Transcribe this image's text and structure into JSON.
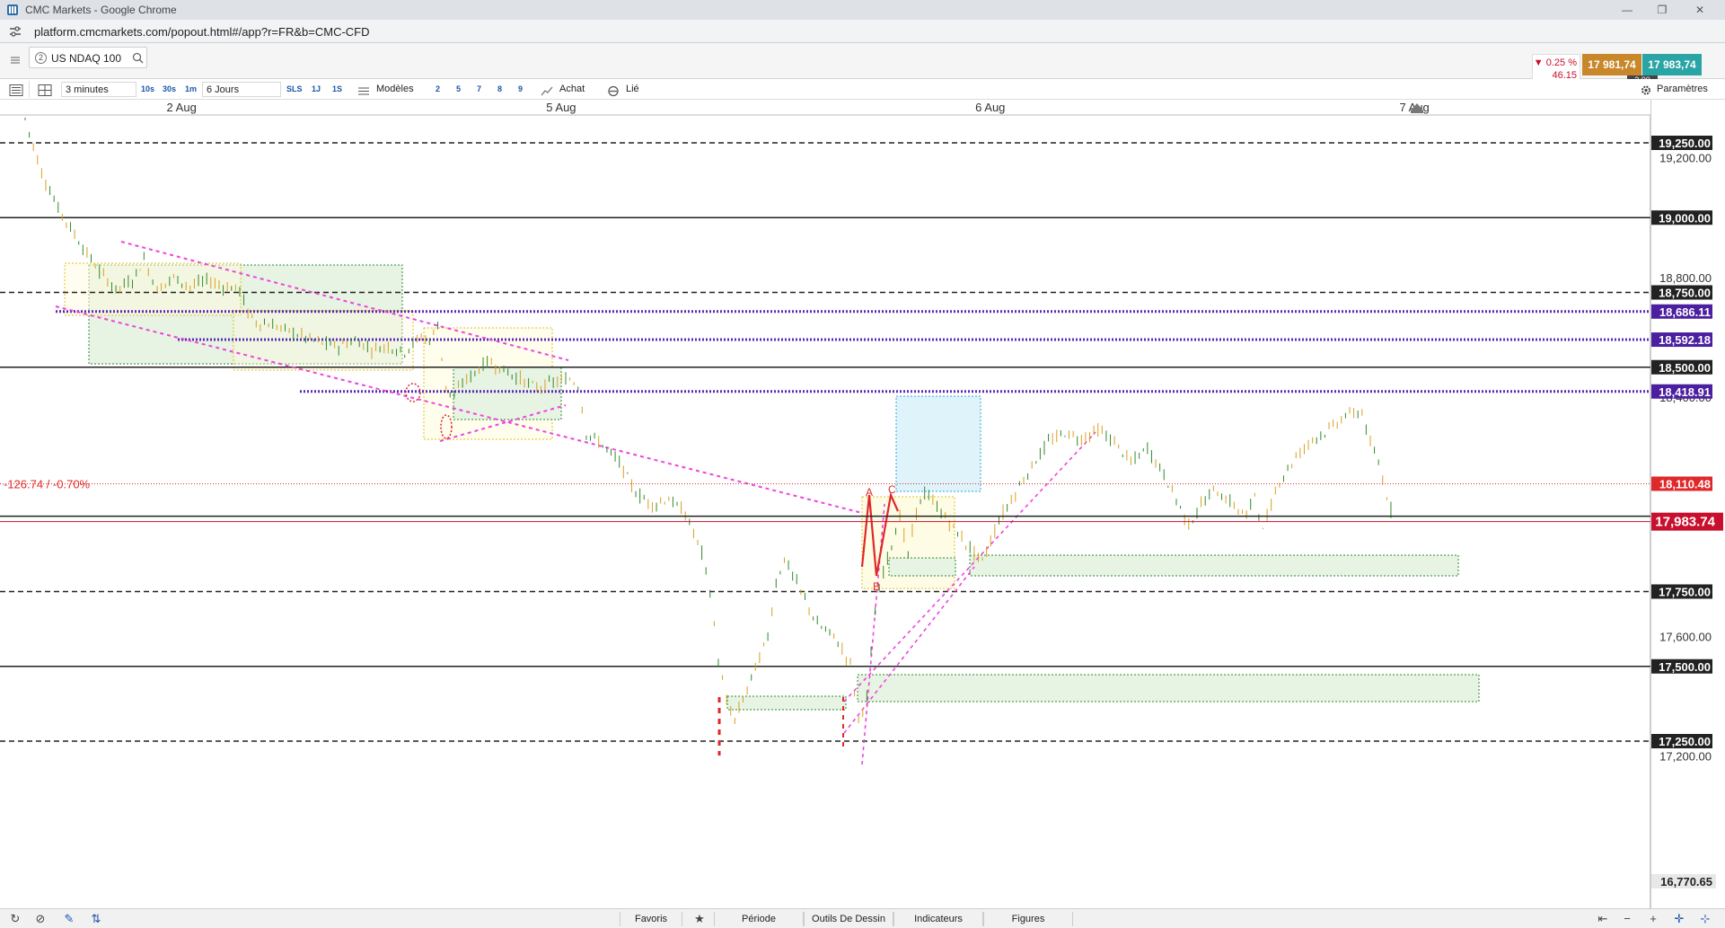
{
  "window": {
    "title": "CMC Markets - Google Chrome",
    "minimize_glyph": "—",
    "restore_glyph": "❐",
    "close_glyph": "✕"
  },
  "address": {
    "url": "platform.cmcmarkets.com/popout.html#/app?r=FR&b=CMC-CFD"
  },
  "instrument": {
    "tab_number": "2",
    "name": "US NDAQ 100",
    "change_pct": "▼ 0.25 %",
    "change_abs": "46.15",
    "sell_price": "17 981,74",
    "buy_price": "17 983,74",
    "spread": "2.00",
    "settings_label": "Paramètres"
  },
  "toolbar": {
    "interval": "3 minutes",
    "quick_intervals": [
      "10s",
      "30s",
      "1m"
    ],
    "range": "6 Jours",
    "range_buttons": [
      "SLS",
      "1J",
      "1S"
    ],
    "templates_label": "Modèles",
    "layout_counts": [
      "2",
      "5",
      "7",
      "8",
      "9"
    ],
    "buy_label": "Achat",
    "linked_label": "Lié"
  },
  "chart_data": {
    "type": "candlestick",
    "instrument": "US NDAQ 100",
    "date_labels": [
      "2 Aug",
      "5 Aug",
      "6 Aug",
      "7 Aug"
    ],
    "y_ticks": [
      "19,200.00",
      "18,800.00",
      "18,400.00",
      "17,600.00",
      "17,200.00"
    ],
    "horizontal_levels": [
      {
        "label": "19,250.00",
        "value": 19250,
        "style": "dashed",
        "color": "#222222"
      },
      {
        "label": "19,000.00",
        "value": 19000,
        "style": "solid",
        "color": "#222222"
      },
      {
        "label": "18,750.00",
        "value": 18750,
        "style": "dashed",
        "color": "#222222"
      },
      {
        "label": "18,686.11",
        "value": 18686.11,
        "style": "dotted",
        "color": "#5b2bb5"
      },
      {
        "label": "18,592.18",
        "value": 18592.18,
        "style": "dotted",
        "color": "#5b2bb5"
      },
      {
        "label": "18,500.00",
        "value": 18500,
        "style": "solid",
        "color": "#222222"
      },
      {
        "label": "18,418.91",
        "value": 18418.91,
        "style": "dotted",
        "color": "#5b2bb5"
      },
      {
        "label": "17,750.00",
        "value": 17750,
        "style": "dashed",
        "color": "#222222"
      },
      {
        "label": "17,500.00",
        "value": 17500,
        "style": "solid",
        "color": "#222222"
      },
      {
        "label": "17,250.00",
        "value": 17250,
        "style": "dashed",
        "color": "#222222"
      }
    ],
    "ref_price": {
      "label": "18,110.48",
      "value": 18110.48,
      "change_text": "-126.74 / -0.70%",
      "color": "#e0282a"
    },
    "current_price": {
      "label": "17,983.74",
      "value": 17983.74,
      "color": "#c8102e"
    },
    "bottom_label": "16,770.65",
    "pattern_labels": [
      "A",
      "B",
      "C"
    ],
    "price_path": [
      [
        0,
        19330
      ],
      [
        0.01,
        19150
      ],
      [
        0.02,
        19030
      ],
      [
        0.035,
        18900
      ],
      [
        0.045,
        18820
      ],
      [
        0.055,
        18760
      ],
      [
        0.065,
        18790
      ],
      [
        0.072,
        18860
      ],
      [
        0.08,
        18760
      ],
      [
        0.09,
        18800
      ],
      [
        0.1,
        18770
      ],
      [
        0.11,
        18790
      ],
      [
        0.12,
        18770
      ],
      [
        0.13,
        18760
      ],
      [
        0.135,
        18680
      ],
      [
        0.14,
        18650
      ],
      [
        0.15,
        18640
      ],
      [
        0.16,
        18620
      ],
      [
        0.17,
        18600
      ],
      [
        0.18,
        18580
      ],
      [
        0.19,
        18570
      ],
      [
        0.2,
        18590
      ],
      [
        0.21,
        18560
      ],
      [
        0.22,
        18570
      ],
      [
        0.23,
        18550
      ],
      [
        0.235,
        18580
      ],
      [
        0.24,
        18600
      ],
      [
        0.245,
        18590
      ],
      [
        0.25,
        18640
      ],
      [
        0.255,
        18430
      ],
      [
        0.26,
        18400
      ],
      [
        0.265,
        18450
      ],
      [
        0.27,
        18470
      ],
      [
        0.28,
        18520
      ],
      [
        0.29,
        18490
      ],
      [
        0.3,
        18460
      ],
      [
        0.31,
        18430
      ],
      [
        0.32,
        18450
      ],
      [
        0.33,
        18460
      ],
      [
        0.335,
        18440
      ],
      [
        0.34,
        18280
      ],
      [
        0.35,
        18240
      ],
      [
        0.36,
        18180
      ],
      [
        0.37,
        18080
      ],
      [
        0.38,
        18040
      ],
      [
        0.39,
        18060
      ],
      [
        0.4,
        18010
      ],
      [
        0.41,
        17880
      ],
      [
        0.415,
        17750
      ],
      [
        0.42,
        17520
      ],
      [
        0.425,
        17380
      ],
      [
        0.43,
        17320
      ],
      [
        0.44,
        17460
      ],
      [
        0.45,
        17600
      ],
      [
        0.455,
        17780
      ],
      [
        0.46,
        17860
      ],
      [
        0.47,
        17750
      ],
      [
        0.48,
        17640
      ],
      [
        0.49,
        17600
      ],
      [
        0.5,
        17510
      ],
      [
        0.505,
        17320
      ],
      [
        0.51,
        17400
      ],
      [
        0.515,
        17680
      ],
      [
        0.52,
        17820
      ],
      [
        0.53,
        18000
      ],
      [
        0.535,
        17870
      ],
      [
        0.54,
        18020
      ],
      [
        0.545,
        18080
      ],
      [
        0.55,
        18050
      ],
      [
        0.56,
        17980
      ],
      [
        0.57,
        17910
      ],
      [
        0.575,
        17880
      ],
      [
        0.58,
        17850
      ],
      [
        0.59,
        17990
      ],
      [
        0.6,
        18080
      ],
      [
        0.61,
        18170
      ],
      [
        0.62,
        18250
      ],
      [
        0.63,
        18280
      ],
      [
        0.64,
        18260
      ],
      [
        0.65,
        18290
      ],
      [
        0.66,
        18250
      ],
      [
        0.67,
        18180
      ],
      [
        0.68,
        18230
      ],
      [
        0.69,
        18140
      ],
      [
        0.7,
        18030
      ],
      [
        0.705,
        17970
      ],
      [
        0.71,
        18020
      ],
      [
        0.72,
        18090
      ],
      [
        0.73,
        18050
      ],
      [
        0.74,
        18000
      ],
      [
        0.745,
        18080
      ],
      [
        0.75,
        17950
      ],
      [
        0.755,
        18040
      ],
      [
        0.76,
        18120
      ],
      [
        0.77,
        18200
      ],
      [
        0.78,
        18260
      ],
      [
        0.79,
        18290
      ],
      [
        0.8,
        18340
      ],
      [
        0.81,
        18350
      ],
      [
        0.815,
        18240
      ],
      [
        0.82,
        18180
      ],
      [
        0.825,
        18070
      ],
      [
        0.83,
        17980
      ]
    ]
  },
  "bottom": {
    "favorites": "Favoris",
    "period": "Période",
    "drawing_tools": "Outils De Dessin",
    "indicators": "Indicateurs",
    "figures": "Figures"
  }
}
